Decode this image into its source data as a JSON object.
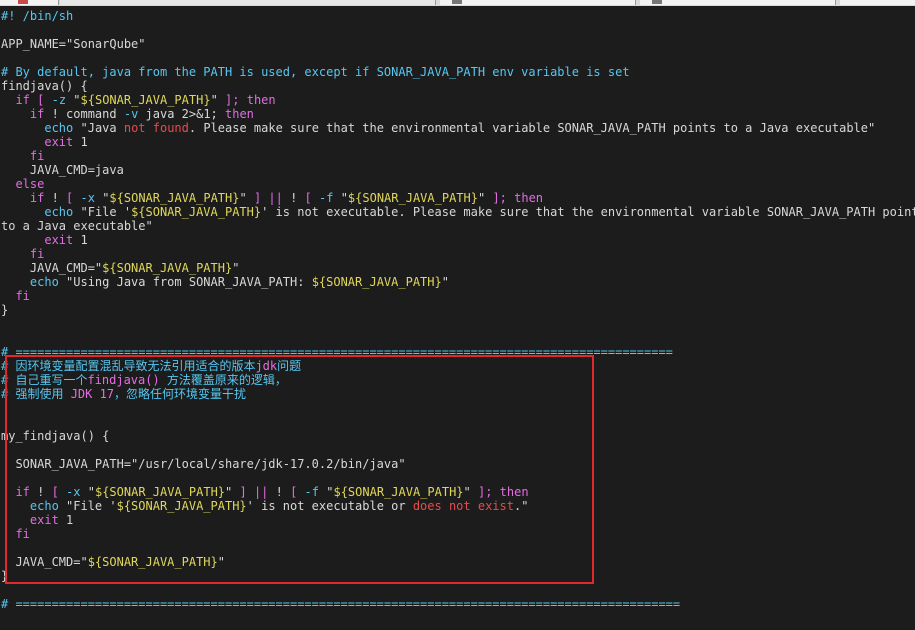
{
  "editor": {
    "lines": [
      [
        {
          "t": "#! /bin/sh",
          "c": "c"
        }
      ],
      [],
      [
        {
          "t": "APP_NAME=\"SonarQube\"",
          "c": "q"
        }
      ],
      [],
      [
        {
          "t": "# By default, java from the PATH is used, except if SONAR_JAVA_PATH env variable is set",
          "c": "c"
        }
      ],
      [
        {
          "t": "findjava() {",
          "c": "q"
        }
      ],
      [
        {
          "t": "  ",
          "c": "q"
        },
        {
          "t": "if",
          "c": "k"
        },
        {
          "t": " ",
          "c": "q"
        },
        {
          "t": "[",
          "c": "k"
        },
        {
          "t": " -z ",
          "c": "c"
        },
        {
          "t": "\"",
          "c": "q"
        },
        {
          "t": "${SONAR_JAVA_PATH}",
          "c": "s"
        },
        {
          "t": "\"",
          "c": "q"
        },
        {
          "t": " ",
          "c": "q"
        },
        {
          "t": "];",
          "c": "k"
        },
        {
          "t": " ",
          "c": "q"
        },
        {
          "t": "then",
          "c": "k"
        }
      ],
      [
        {
          "t": "    ",
          "c": "q"
        },
        {
          "t": "if",
          "c": "k"
        },
        {
          "t": " ! command ",
          "c": "q"
        },
        {
          "t": "-v",
          "c": "c"
        },
        {
          "t": " java 2>&1; ",
          "c": "q"
        },
        {
          "t": "then",
          "c": "k"
        }
      ],
      [
        {
          "t": "      ",
          "c": "q"
        },
        {
          "t": "echo",
          "c": "c"
        },
        {
          "t": " \"Java ",
          "c": "q"
        },
        {
          "t": "not found",
          "c": "r"
        },
        {
          "t": ". Please make sure that the environmental variable SONAR_JAVA_PATH points to a Java executable\"",
          "c": "q"
        }
      ],
      [
        {
          "t": "      ",
          "c": "q"
        },
        {
          "t": "exit",
          "c": "k"
        },
        {
          "t": " 1",
          "c": "q"
        }
      ],
      [
        {
          "t": "    ",
          "c": "q"
        },
        {
          "t": "fi",
          "c": "k"
        }
      ],
      [
        {
          "t": "    JAVA_CMD=java",
          "c": "q"
        }
      ],
      [
        {
          "t": "  ",
          "c": "q"
        },
        {
          "t": "else",
          "c": "k"
        }
      ],
      [
        {
          "t": "    ",
          "c": "q"
        },
        {
          "t": "if",
          "c": "k"
        },
        {
          "t": " ! ",
          "c": "q"
        },
        {
          "t": "[",
          "c": "k"
        },
        {
          "t": " -x ",
          "c": "c"
        },
        {
          "t": "\"",
          "c": "q"
        },
        {
          "t": "${SONAR_JAVA_PATH}",
          "c": "s"
        },
        {
          "t": "\"",
          "c": "q"
        },
        {
          "t": " ",
          "c": "q"
        },
        {
          "t": "]",
          "c": "k"
        },
        {
          "t": " ",
          "c": "q"
        },
        {
          "t": "||",
          "c": "k"
        },
        {
          "t": " ! ",
          "c": "q"
        },
        {
          "t": "[",
          "c": "k"
        },
        {
          "t": " -f ",
          "c": "c"
        },
        {
          "t": "\"",
          "c": "q"
        },
        {
          "t": "${SONAR_JAVA_PATH}",
          "c": "s"
        },
        {
          "t": "\"",
          "c": "q"
        },
        {
          "t": " ",
          "c": "q"
        },
        {
          "t": "];",
          "c": "k"
        },
        {
          "t": " ",
          "c": "q"
        },
        {
          "t": "then",
          "c": "k"
        }
      ],
      [
        {
          "t": "      ",
          "c": "q"
        },
        {
          "t": "echo",
          "c": "c"
        },
        {
          "t": " \"File '",
          "c": "q"
        },
        {
          "t": "${SONAR_JAVA_PATH}",
          "c": "s"
        },
        {
          "t": "' is not executable. Please make sure that the environmental variable SONAR_JAVA_PATH points",
          "c": "q"
        }
      ],
      [
        {
          "t": "to a Java executable\"",
          "c": "q"
        }
      ],
      [
        {
          "t": "      ",
          "c": "q"
        },
        {
          "t": "exit",
          "c": "k"
        },
        {
          "t": " 1",
          "c": "q"
        }
      ],
      [
        {
          "t": "    ",
          "c": "q"
        },
        {
          "t": "fi",
          "c": "k"
        }
      ],
      [
        {
          "t": "    JAVA_CMD=\"",
          "c": "q"
        },
        {
          "t": "${SONAR_JAVA_PATH}",
          "c": "s"
        },
        {
          "t": "\"",
          "c": "q"
        }
      ],
      [
        {
          "t": "    ",
          "c": "q"
        },
        {
          "t": "echo",
          "c": "c"
        },
        {
          "t": " \"Using Java from SONAR_JAVA_PATH: ",
          "c": "q"
        },
        {
          "t": "${SONAR_JAVA_PATH}",
          "c": "s"
        },
        {
          "t": "\"",
          "c": "q"
        }
      ],
      [
        {
          "t": "  ",
          "c": "q"
        },
        {
          "t": "fi",
          "c": "k"
        }
      ],
      [
        {
          "t": "}",
          "c": "q"
        }
      ],
      [],
      [],
      [
        {
          "t": "# ===========================================================================================",
          "c": "c"
        }
      ],
      [
        {
          "t": "# 因环境变量配置混乱导致无法引用适合的版本",
          "c": "c"
        },
        {
          "t": "jdk",
          "c": "k"
        },
        {
          "t": "问题",
          "c": "c"
        }
      ],
      [
        {
          "t": "# 自己重写一个",
          "c": "c"
        },
        {
          "t": "findjava()",
          "c": "k"
        },
        {
          "t": " 方法覆盖原来的逻辑，",
          "c": "c"
        }
      ],
      [
        {
          "t": "# 强制使用 ",
          "c": "c"
        },
        {
          "t": "JDK 17",
          "c": "k"
        },
        {
          "t": "，忽略任何环境变量干扰",
          "c": "c"
        }
      ],
      [],
      [],
      [
        {
          "t": "my_findjava() {",
          "c": "q"
        }
      ],
      [],
      [
        {
          "t": "  SONAR_JAVA_PATH=\"/usr/local/share/jdk-17.0.2/bin/java\"",
          "c": "q"
        }
      ],
      [],
      [
        {
          "t": "  ",
          "c": "q"
        },
        {
          "t": "if",
          "c": "k"
        },
        {
          "t": " ! ",
          "c": "q"
        },
        {
          "t": "[",
          "c": "k"
        },
        {
          "t": " -x ",
          "c": "c"
        },
        {
          "t": "\"",
          "c": "q"
        },
        {
          "t": "${SONAR_JAVA_PATH}",
          "c": "s"
        },
        {
          "t": "\"",
          "c": "q"
        },
        {
          "t": " ",
          "c": "q"
        },
        {
          "t": "]",
          "c": "k"
        },
        {
          "t": " ",
          "c": "q"
        },
        {
          "t": "||",
          "c": "k"
        },
        {
          "t": " ! ",
          "c": "q"
        },
        {
          "t": "[",
          "c": "k"
        },
        {
          "t": " -f ",
          "c": "c"
        },
        {
          "t": "\"",
          "c": "q"
        },
        {
          "t": "${SONAR_JAVA_PATH}",
          "c": "s"
        },
        {
          "t": "\"",
          "c": "q"
        },
        {
          "t": " ",
          "c": "q"
        },
        {
          "t": "];",
          "c": "k"
        },
        {
          "t": " ",
          "c": "q"
        },
        {
          "t": "then",
          "c": "k"
        }
      ],
      [
        {
          "t": "    ",
          "c": "q"
        },
        {
          "t": "echo",
          "c": "c"
        },
        {
          "t": " \"File '",
          "c": "q"
        },
        {
          "t": "${SONAR_JAVA_PATH}",
          "c": "s"
        },
        {
          "t": "' is not executable or ",
          "c": "q"
        },
        {
          "t": "does not exist",
          "c": "r"
        },
        {
          "t": ".\"",
          "c": "q"
        }
      ],
      [
        {
          "t": "    ",
          "c": "q"
        },
        {
          "t": "exit",
          "c": "k"
        },
        {
          "t": " 1",
          "c": "q"
        }
      ],
      [
        {
          "t": "  ",
          "c": "q"
        },
        {
          "t": "fi",
          "c": "k"
        }
      ],
      [],
      [
        {
          "t": "  JAVA_CMD=\"",
          "c": "q"
        },
        {
          "t": "${SONAR_JAVA_PATH}",
          "c": "s"
        },
        {
          "t": "\"",
          "c": "q"
        }
      ],
      [
        {
          "t": "}",
          "c": "q"
        }
      ],
      [],
      [
        {
          "t": "# ============================================================================================",
          "c": "c"
        }
      ]
    ]
  },
  "colors": {
    "background": "#1c1c1c",
    "comment": "#55c7f2",
    "keyword": "#e36de3",
    "variable": "#e0d75a",
    "error_text": "#ea4a4a",
    "annotation_box": "#e0282d"
  }
}
